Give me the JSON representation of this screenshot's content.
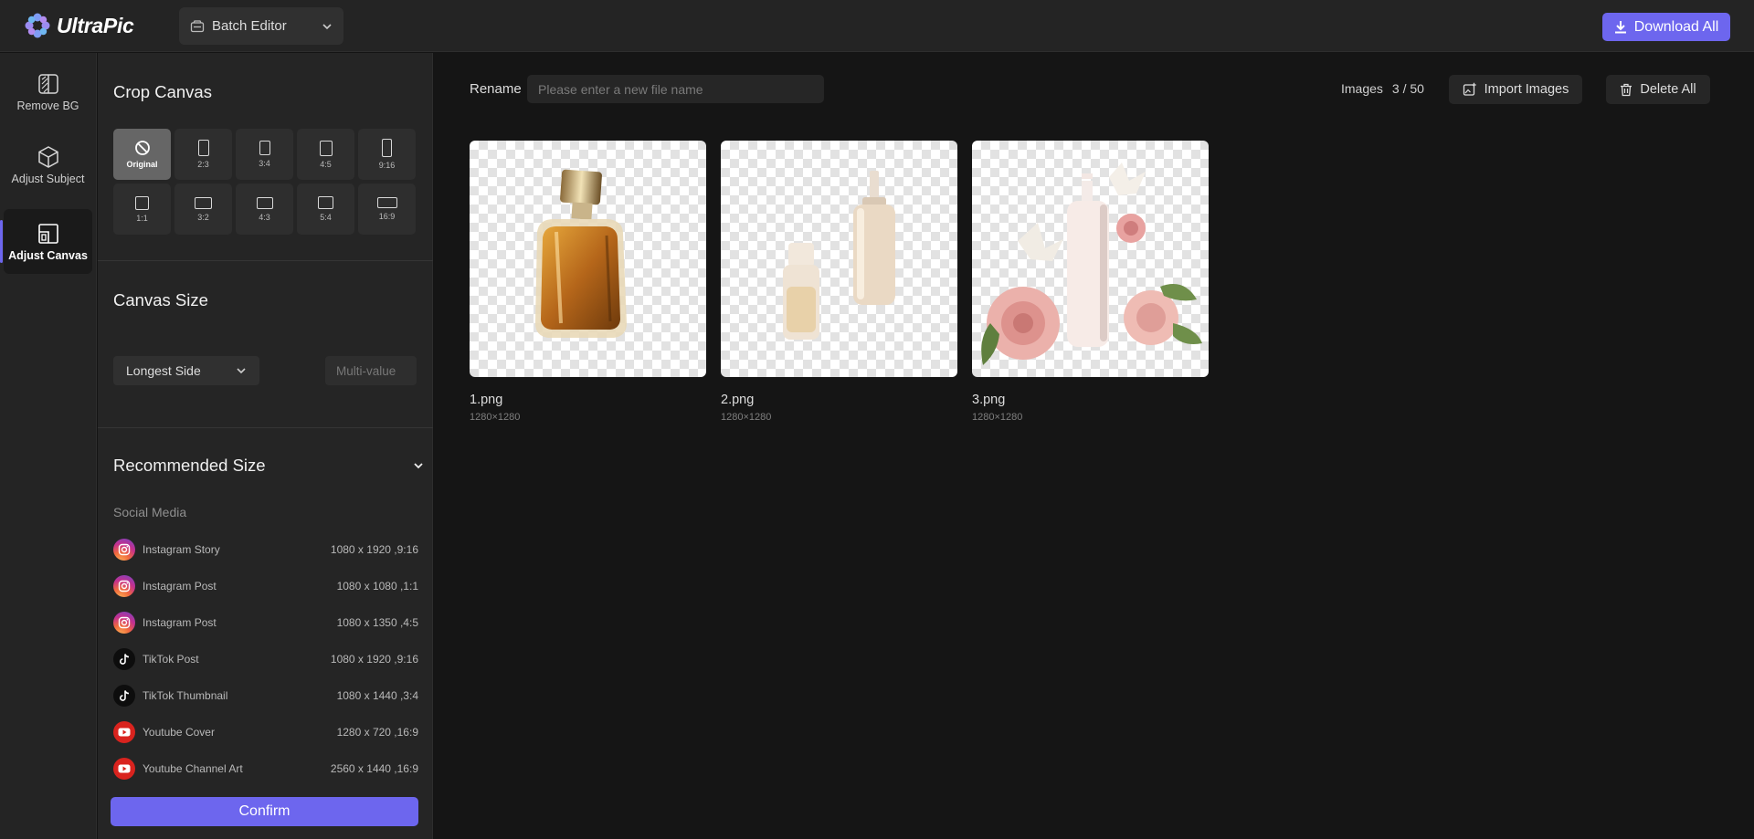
{
  "app": {
    "logo_text": "UltraPic",
    "mode_selector": "Batch Editor",
    "download_all": "Download All",
    "accent_color": "#6d66ee"
  },
  "rail": [
    {
      "label": "Remove BG",
      "icon": "remove-bg-icon",
      "active": false
    },
    {
      "label": "Adjust Subject",
      "icon": "cube-icon",
      "active": false
    },
    {
      "label": "Adjust Canvas",
      "icon": "canvas-icon",
      "active": true
    }
  ],
  "crop": {
    "title": "Crop Canvas",
    "ratios": [
      "Original",
      "2:3",
      "3:4",
      "4:5",
      "9:16",
      "1:1",
      "3:2",
      "4:3",
      "5:4",
      "16:9"
    ],
    "selected": "Original"
  },
  "canvas_size": {
    "title": "Canvas Size",
    "side_option": "Longest Side",
    "value_placeholder": "Multi-value"
  },
  "recommended": {
    "title": "Recommended Size",
    "category": "Social Media",
    "presets": [
      {
        "name": "Instagram Story",
        "size": "1080 x 1920 ,9:16",
        "icon": "instagram-icon"
      },
      {
        "name": "Instagram Post",
        "size": "1080 x 1080 ,1:1",
        "icon": "instagram-icon"
      },
      {
        "name": "Instagram Post",
        "size": "1080 x 1350 ,4:5",
        "icon": "instagram-icon"
      },
      {
        "name": "TikTok Post",
        "size": "1080 x 1920 ,9:16",
        "icon": "tiktok-icon"
      },
      {
        "name": "TikTok Thumbnail",
        "size": "1080 x 1440 ,3:4",
        "icon": "tiktok-icon"
      },
      {
        "name": "Youtube Cover",
        "size": "1280 x 720 ,16:9",
        "icon": "youtube-icon"
      },
      {
        "name": "Youtube Channel Art",
        "size": "2560 x 1440 ,16:9",
        "icon": "youtube-icon"
      }
    ],
    "confirm": "Confirm"
  },
  "main": {
    "rename_label": "Rename",
    "rename_placeholder": "Please enter a new file name",
    "images_label": "Images",
    "images_count": "3 / 50",
    "import_label": "Import Images",
    "delete_label": "Delete All",
    "images": [
      {
        "name": "1.png",
        "dims": "1280×1280"
      },
      {
        "name": "2.png",
        "dims": "1280×1280"
      },
      {
        "name": "3.png",
        "dims": "1280×1280"
      }
    ]
  }
}
